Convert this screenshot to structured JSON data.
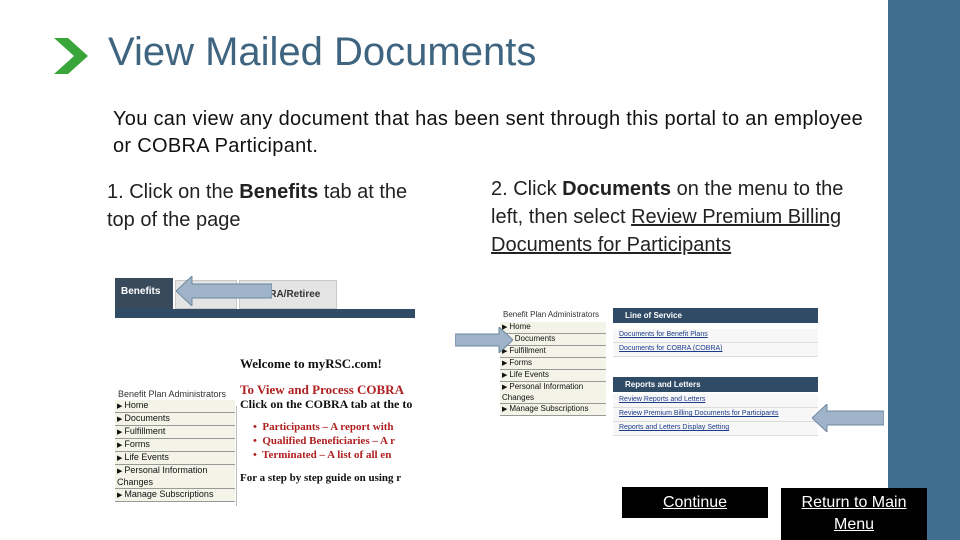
{
  "slide": {
    "title": "View Mailed Documents",
    "intro": "You can view any document that has been sent through this portal to an employee or COBRA Participant.",
    "step1": {
      "prefix": "1. Click on the ",
      "bold": "Benefits",
      "suffix": " tab at the top of the page"
    },
    "step2": {
      "prefix": "2. Click ",
      "bold": "Documents",
      "middle": " on the menu to the left, then select ",
      "link": "Review Premium Billing Documents for Participants"
    },
    "buttons": {
      "continue": "Continue",
      "return": "Return to Main Menu"
    }
  },
  "screenshot1": {
    "tabs": [
      "Benefits",
      "",
      "BRA/Retiree"
    ],
    "welcome": "Welcome to myRSC.com!",
    "heading": "To View and Process COBRA",
    "instruction": "Click on the COBRA tab at the to",
    "bullets": [
      "Participants – A report with",
      "Qualified Beneficiaries – A r",
      "Terminated – A list of all en"
    ],
    "guide": "For a step by step guide on using r",
    "menu_title": "Benefit Plan Administrators",
    "menu_items": [
      "Home",
      "Documents",
      "Fulfillment",
      "Forms",
      "Life Events",
      "Personal Information Changes",
      "Manage Subscriptions"
    ]
  },
  "screenshot2": {
    "menu_title": "Benefit Plan Administrators",
    "menu_items": [
      "Home",
      "Documents",
      "Fulfillment",
      "Forms",
      "Life Events",
      "Personal Information Changes",
      "Manage Subscriptions"
    ],
    "line_of_service": {
      "header": "Line of Service",
      "items": [
        "Documents for Benefit Plans",
        "Documents for COBRA (COBRA)"
      ]
    },
    "reports": {
      "header": "Reports and Letters",
      "items": [
        "Review Reports and Letters",
        "Review Premium Billing Documents for Participants",
        "Reports and Letters Display Setting"
      ]
    }
  },
  "colors": {
    "accent": "#3f6e8f",
    "title": "#3f6480",
    "chevron": "#3aa63a",
    "arrow": "#9fb4c8"
  }
}
